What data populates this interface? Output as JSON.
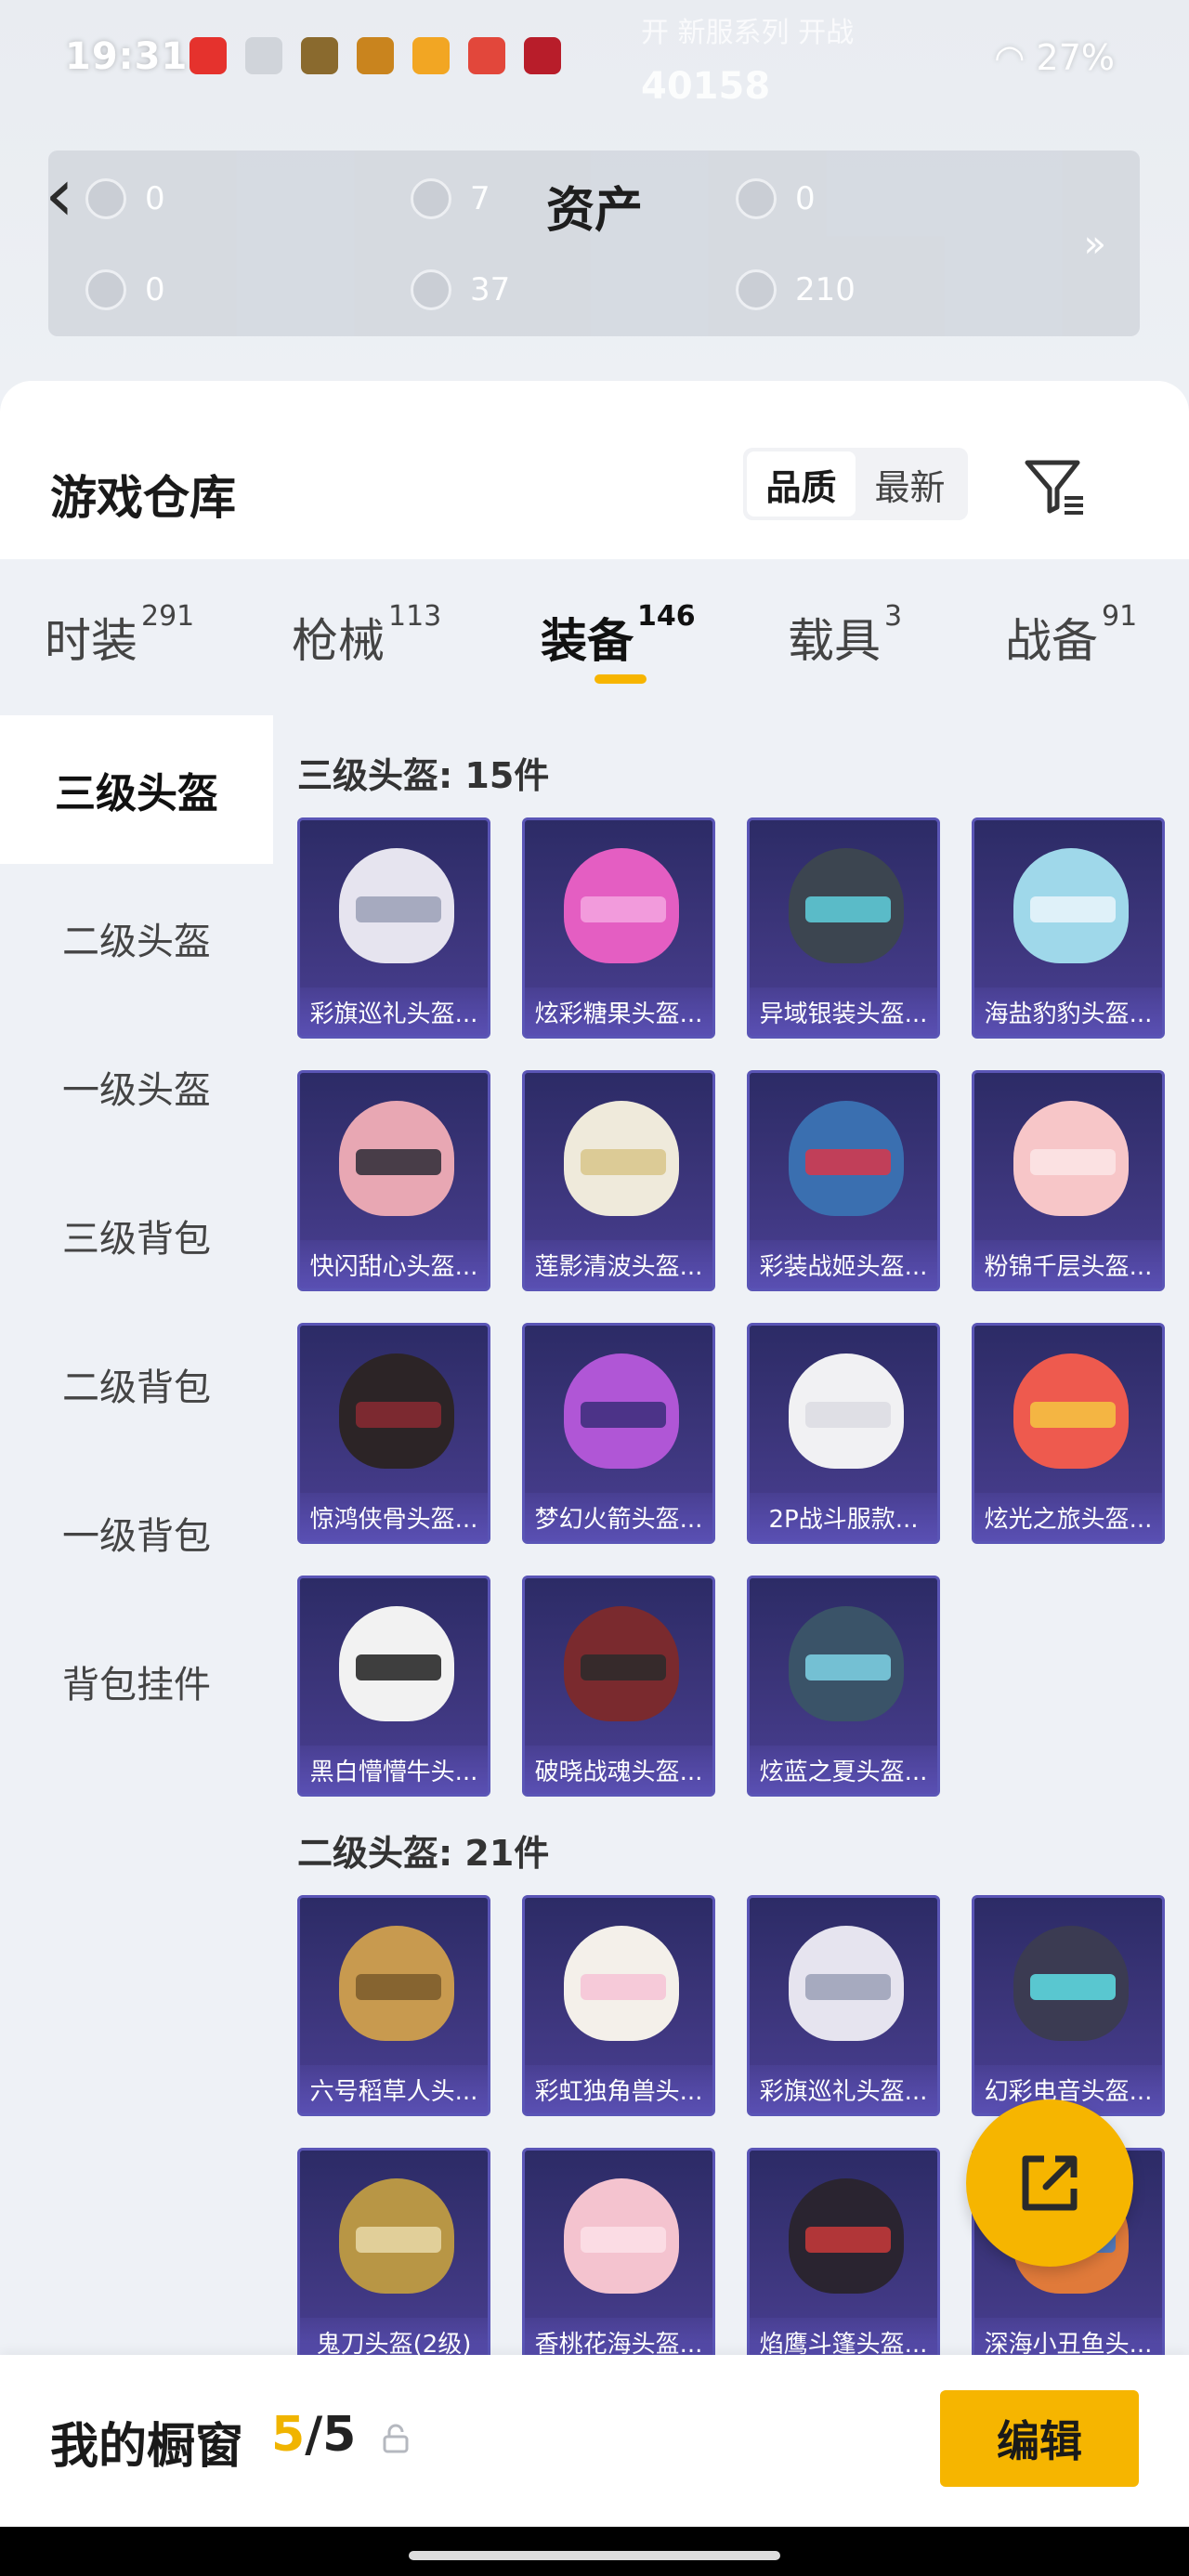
{
  "status": {
    "time": "19:31",
    "faint_top": "开 新服系列 开战",
    "faint_value": "40158",
    "battery": "27%"
  },
  "header": {
    "title": "资产"
  },
  "assets": [
    {
      "value": "0"
    },
    {
      "value": "7"
    },
    {
      "value": "0"
    },
    {
      "value": "0"
    },
    {
      "value": "37"
    },
    {
      "value": "210"
    }
  ],
  "warehouse": {
    "title": "游戏仓库",
    "sort_options": [
      "品质",
      "最新"
    ],
    "active_sort": "品质"
  },
  "tabs": [
    {
      "label": "时装",
      "count": "291"
    },
    {
      "label": "枪械",
      "count": "113"
    },
    {
      "label": "装备",
      "count": "146"
    },
    {
      "label": "载具",
      "count": "3"
    },
    {
      "label": "战备",
      "count": "91"
    }
  ],
  "active_tab": "装备",
  "sidebar": {
    "items": [
      "三级头盔",
      "二级头盔",
      "一级头盔",
      "三级背包",
      "二级背包",
      "一级背包",
      "背包挂件"
    ],
    "active": "三级头盔"
  },
  "sections": [
    {
      "title": "三级头盔: 15件",
      "items": [
        "彩旗巡礼头盔...",
        "炫彩糖果头盔...",
        "异域银装头盔...",
        "海盐豹豹头盔...",
        "快闪甜心头盔...",
        "莲影清波头盔...",
        "彩装战姬头盔...",
        "粉锦千层头盔...",
        "惊鸿侠骨头盔...",
        "梦幻火箭头盔...",
        "2P战斗服款...",
        "炫光之旅头盔...",
        "黑白懵懵牛头...",
        "破晓战魂头盔...",
        "炫蓝之夏头盔..."
      ]
    },
    {
      "title": "二级头盔: 21件",
      "items": [
        "六号稻草人头...",
        "彩虹独角兽头...",
        "彩旗巡礼头盔...",
        "幻彩电音头盔...",
        "鬼刀头盔(2级)",
        "香桃花海头盔...",
        "焰鹰斗篷头盔...",
        "深海小丑鱼头..."
      ]
    }
  ],
  "colors": {
    "accent": "#f6b500",
    "card_bg": "#3a3478",
    "card_border": "#5a55b6"
  },
  "showcase": {
    "title": "我的橱窗",
    "current": "5",
    "sep_total": "/5",
    "edit_label": "编辑"
  }
}
